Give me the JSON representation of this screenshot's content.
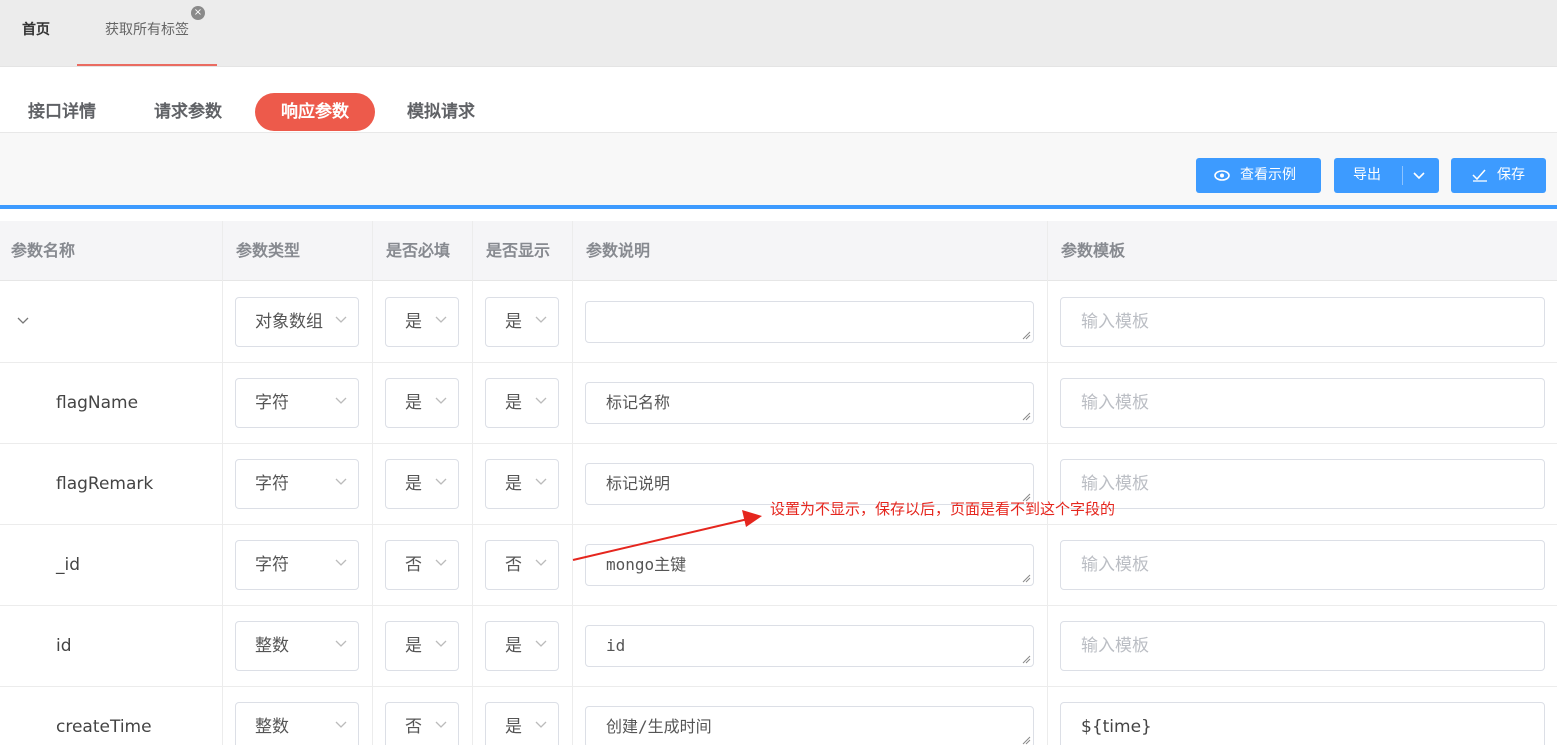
{
  "top_tabs": {
    "home": "首页",
    "current": "获取所有标签",
    "close_glyph": "×"
  },
  "sub_tabs": [
    "接口详情",
    "请求参数",
    "响应参数",
    "模拟请求"
  ],
  "active_sub_tab": "响应参数",
  "toolbar": {
    "view_example": "查看示例",
    "export": "导出",
    "save": "保存"
  },
  "table": {
    "headers": [
      "参数名称",
      "参数类型",
      "是否必填",
      "是否显示",
      "参数说明",
      "参数模板"
    ],
    "template_placeholder": "输入模板",
    "rows": [
      {
        "name": "",
        "type": "对象数组",
        "required": "是",
        "display": "是",
        "description": "",
        "template": ""
      },
      {
        "name": "flagName",
        "type": "字符",
        "required": "是",
        "display": "是",
        "description": "标记名称",
        "template": ""
      },
      {
        "name": "flagRemark",
        "type": "字符",
        "required": "是",
        "display": "是",
        "description": "标记说明",
        "template": ""
      },
      {
        "name": "_id",
        "type": "字符",
        "required": "否",
        "display": "否",
        "description": "mongo主键",
        "template": ""
      },
      {
        "name": "id",
        "type": "整数",
        "required": "是",
        "display": "是",
        "description": "id",
        "template": ""
      },
      {
        "name": "createTime",
        "type": "整数",
        "required": "否",
        "display": "是",
        "description": "创建/生成时间",
        "template": "${time}"
      }
    ]
  },
  "annotation": {
    "text": "设置为不显示，保存以后，页面是看不到这个字段的",
    "color": "#e5261e"
  },
  "colors": {
    "accent_blue": "#3d9bff",
    "active_tab_red": "#ed5a4b"
  }
}
